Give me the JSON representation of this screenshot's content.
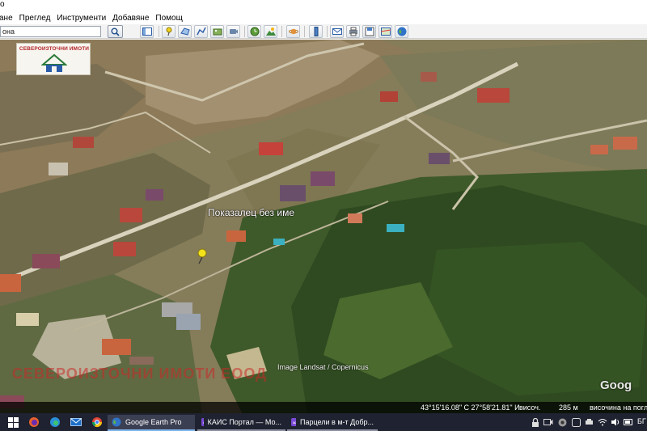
{
  "window": {
    "app_letter": "о"
  },
  "menu": [
    "ане",
    "Преглед",
    "Инструменти",
    "Добавяне",
    "Помощ"
  ],
  "search": {
    "value": "она"
  },
  "map": {
    "logo_text": "СЕВЕРОИЗТОЧНИ ИМОТИ",
    "placemark_label": "Показалец без име",
    "watermark": "СЕВЕРОИЗТОЧНИ ИМОТИ ЕООД",
    "attribution": "Image Landsat / Copernicus",
    "brand": "Goog"
  },
  "status": {
    "coords": "43°15'16.08\" С  27°58'21.81\" И",
    "elevation_label": "височ.",
    "elevation_value": "285 м",
    "eye_alt": "височина на погл"
  },
  "taskbar": {
    "apps": [
      {
        "label": "Google Earth Pro"
      },
      {
        "label": "КАИС Портал — Мо..."
      },
      {
        "label": "Парцели в м-т Добр..."
      }
    ],
    "lang": "БГ"
  },
  "colors": {
    "accent": "#7eb4ea",
    "placemark": "#f2e21a",
    "watermark": "#c82828"
  }
}
